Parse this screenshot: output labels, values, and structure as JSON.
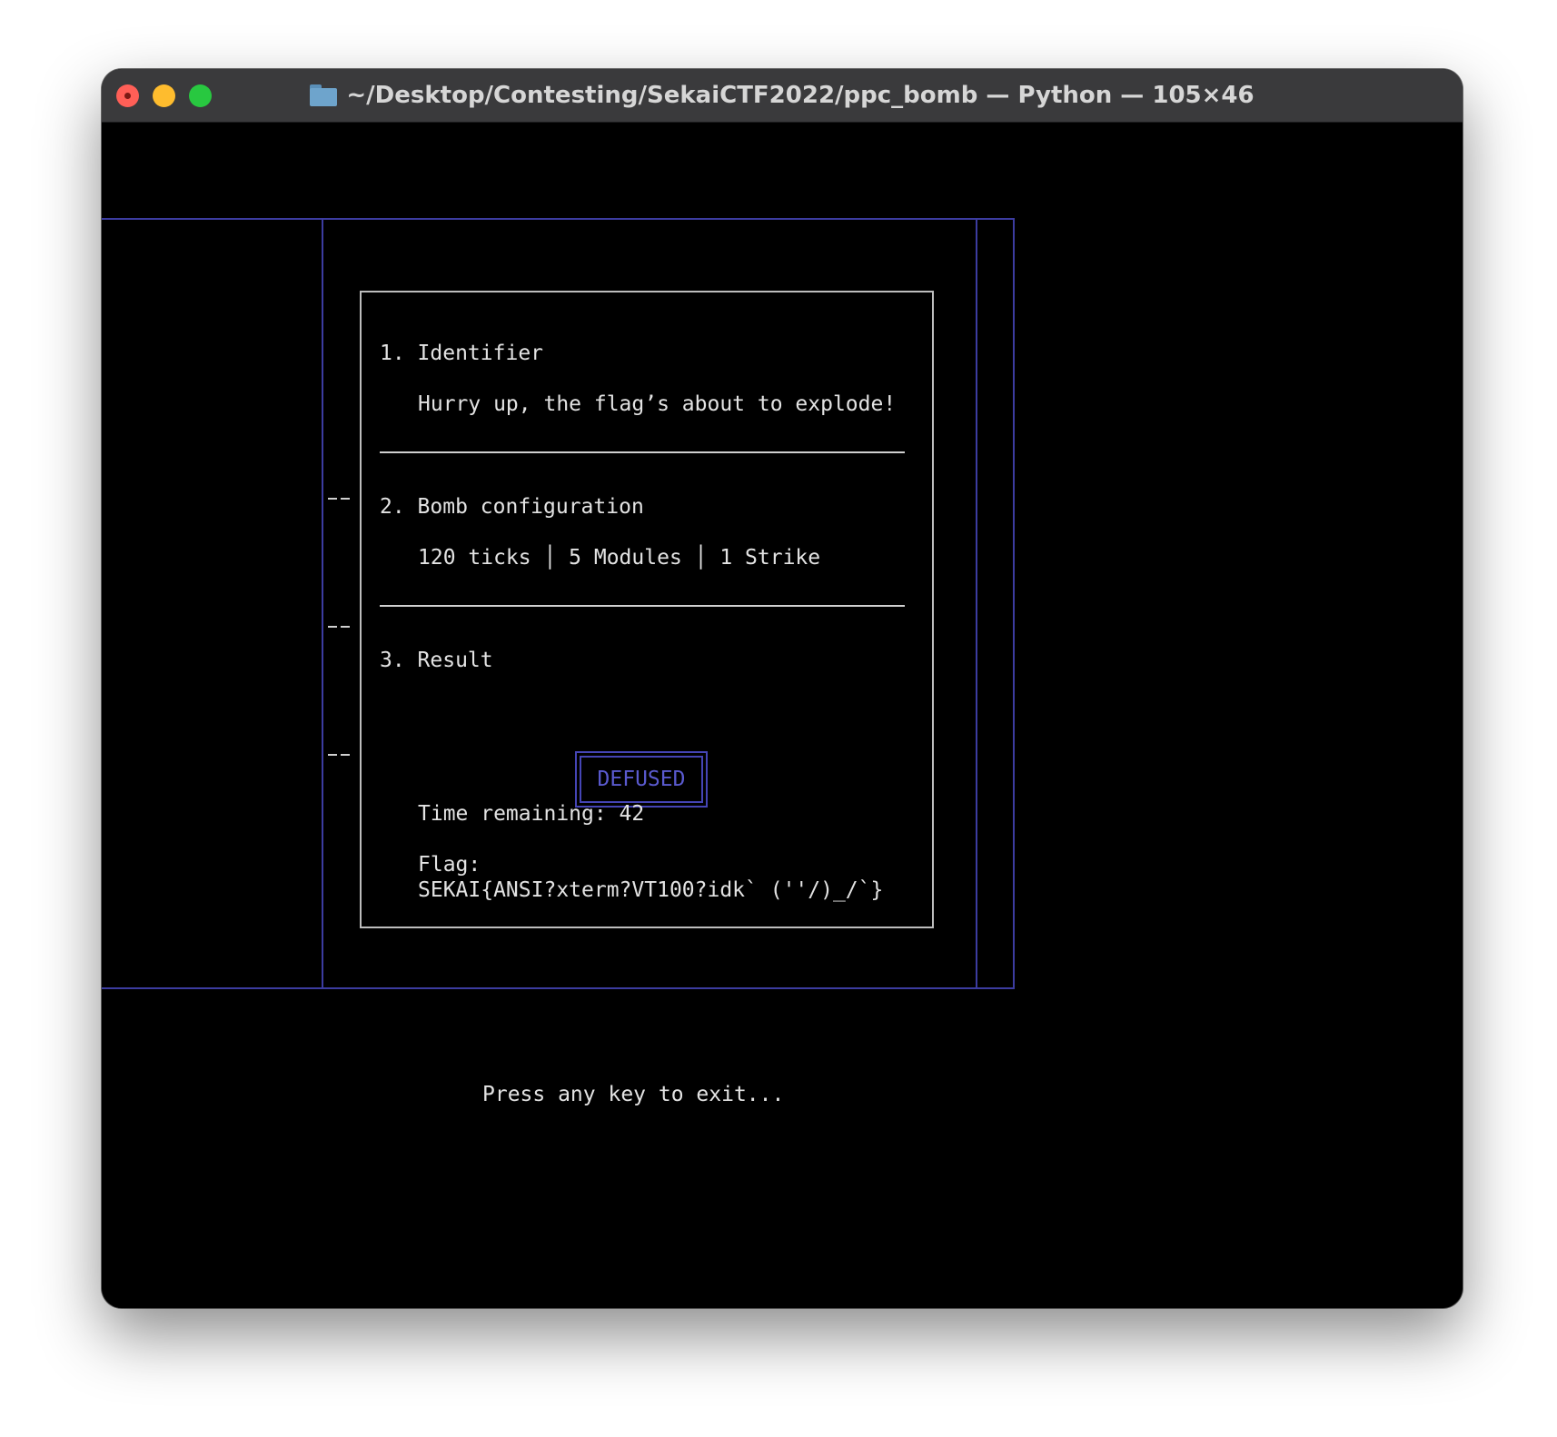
{
  "window": {
    "title": "~/Desktop/Contesting/SekaiCTF2022/ppc_bomb — Python — 105×46"
  },
  "panel": {
    "section1": {
      "heading": "1. Identifier",
      "text": "Hurry up, the flag’s about to explode!"
    },
    "section2": {
      "heading": "2. Bomb configuration",
      "text": "120 ticks │ 5 Modules │ 1 Strike"
    },
    "section3": {
      "heading": "3. Result",
      "status": "DEFUSED",
      "time_remaining": "Time remaining: 42",
      "flag_label": "Flag:",
      "flag_value": "SEKAI{ANSI?xterm?VT100?idk` (''/)_/`}"
    }
  },
  "footer": {
    "exit_prompt": "Press any key to exit..."
  },
  "colors": {
    "frame": "#3c3ca0",
    "status": "#5a5acf",
    "text": "#e3e3e3"
  }
}
